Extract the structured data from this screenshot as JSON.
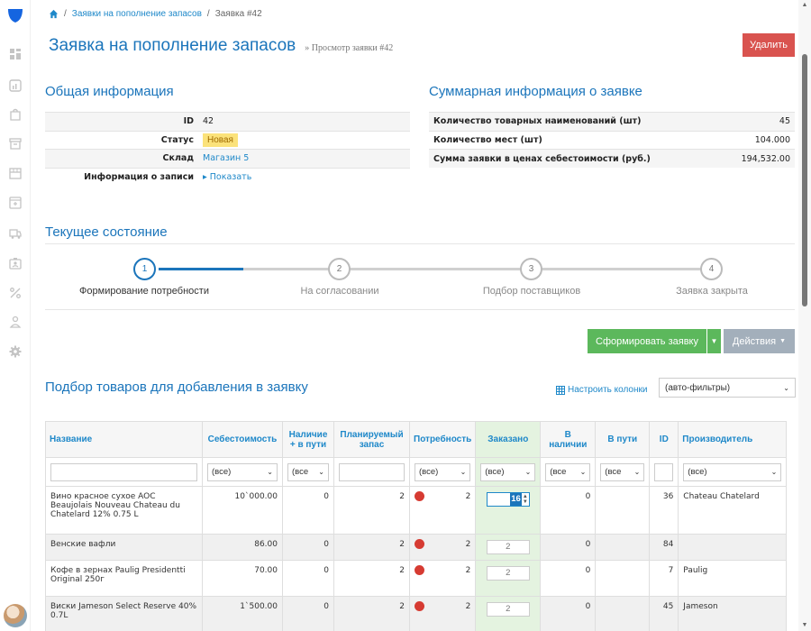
{
  "breadcrumb": {
    "home_label": "",
    "items": [
      "Заявки на пополнение запасов",
      "Заявка #42"
    ],
    "separator": "/"
  },
  "header": {
    "title": "Заявка на пополнение запасов",
    "subtitle": "» Просмотр заявки #42",
    "delete_label": "Удалить"
  },
  "general": {
    "title": "Общая информация",
    "rows": [
      {
        "key": "ID",
        "value": "42"
      },
      {
        "key": "Статус",
        "value": "Новая"
      },
      {
        "key": "Склад",
        "value": "Магазин 5"
      },
      {
        "key": "Информация о записи",
        "value": "▸ Показать"
      }
    ]
  },
  "summary": {
    "title": "Суммарная информация о заявке",
    "rows": [
      {
        "key": "Количество товарных наименований (шт)",
        "value": "45"
      },
      {
        "key": "Количество мест (шт)",
        "value": "104.000"
      },
      {
        "key": "Сумма заявки в ценах себестоимости (руб.)",
        "value": "194,532.00"
      }
    ]
  },
  "state": {
    "title": "Текущее состояние",
    "steps": [
      {
        "num": "1",
        "label": "Формирование потребности",
        "active": true
      },
      {
        "num": "2",
        "label": "На согласовании",
        "active": false
      },
      {
        "num": "3",
        "label": "Подбор поставщиков",
        "active": false
      },
      {
        "num": "4",
        "label": "Заявка закрыта",
        "active": false
      }
    ]
  },
  "actions": {
    "form_label": "Сформировать заявку",
    "actions_label": "Действия"
  },
  "picker": {
    "title": "Подбор товаров для добавления в заявку",
    "configure_columns": "Настроить колонки",
    "autofilter": "(авто-фильтры)"
  },
  "table": {
    "columns": [
      "Название",
      "Себестоимость",
      "Наличие + в пути",
      "Планируемый запас",
      "Потребность",
      "Заказано",
      "В наличии",
      "В пути",
      "ID",
      "Производитель"
    ],
    "filters": {
      "all": "(все)",
      "all_short": "(все"
    },
    "rows": [
      {
        "name": "Вино красное сухое AOC Beaujolais Nouveau Chateau du Chatelard 12% 0.75 L",
        "cost": "10`000.00",
        "avail": "0",
        "planned": "2",
        "need": "2",
        "ordered": "16",
        "instock": "0",
        "transit": "",
        "id": "36",
        "maker": "Chateau Chatelard"
      },
      {
        "name": "Венские вафли",
        "cost": "86.00",
        "avail": "0",
        "planned": "2",
        "need": "2",
        "ordered": "2",
        "instock": "0",
        "transit": "",
        "id": "84",
        "maker": ""
      },
      {
        "name": "Кофе в зернах Paulig Presidentti Original 250г",
        "cost": "70.00",
        "avail": "0",
        "planned": "2",
        "need": "2",
        "ordered": "2",
        "instock": "0",
        "transit": "",
        "id": "7",
        "maker": "Paulig"
      },
      {
        "name": "Виски Jameson Select Reserve 40% 0.7L",
        "cost": "1`500.00",
        "avail": "0",
        "planned": "2",
        "need": "2",
        "ordered": "2",
        "instock": "0",
        "transit": "",
        "id": "45",
        "maker": "Jameson"
      }
    ]
  },
  "colors": {
    "brand": "#1b75bb",
    "link": "#1e88c9",
    "danger": "#d9534f",
    "success": "#5cb85c",
    "status_badge": "#fbe27a"
  }
}
